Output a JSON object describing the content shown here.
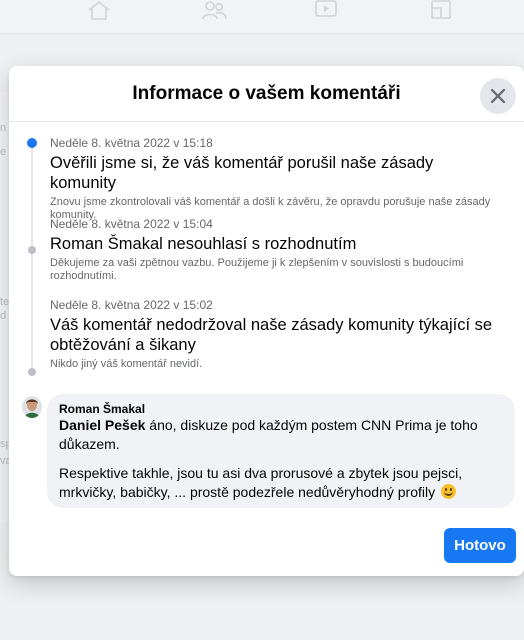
{
  "modal": {
    "title": "Informace o vašem komentáři",
    "done_label": "Hotovo"
  },
  "timeline": [
    {
      "date": "Neděle 8. května 2022 v 15:18",
      "heading": "Ověřili jsme si, že váš komentář porušil naše zásady komunity",
      "description": "Znovu jsme zkontrolovali váš komentář a došli k závěru, že opravdu porušuje naše zásady komunity.",
      "active": true
    },
    {
      "date": "Neděle 8. května 2022 v 15:04",
      "heading": "Roman Šmakal nesouhlasí s rozhodnutím",
      "description": "Děkujeme za vaši zpětnou vazbu. Použijeme ji k zlepšením v souvislosti s budoucími rozhodnutími.",
      "active": false
    },
    {
      "date": "Neděle 8. května 2022 v 15:02",
      "heading": "Váš komentář nedodržoval naše zásady komunity týkající se obtěžování a šikany",
      "description": "Nikdo jiný váš komentář nevidí.",
      "active": false
    }
  ],
  "comment": {
    "author": "Roman Šmakal",
    "mention": "Daniel Pešek",
    "text_1": " áno, diskuze pod každým postem CNN Prima je toho důkazem.",
    "text_2": "Respektive takhle, jsou tu asi dva prorusové a zbytek jsou pejsci, mrkvičky, babičky, ... prostě podezřele nedůvěryhodný profily",
    "emoji": "smiling-face-icon"
  },
  "colors": {
    "accent": "#1877f2",
    "active_dot": "#1877f2",
    "inactive_dot": "#bcc0c4",
    "secondary_text": "#65676b"
  }
}
